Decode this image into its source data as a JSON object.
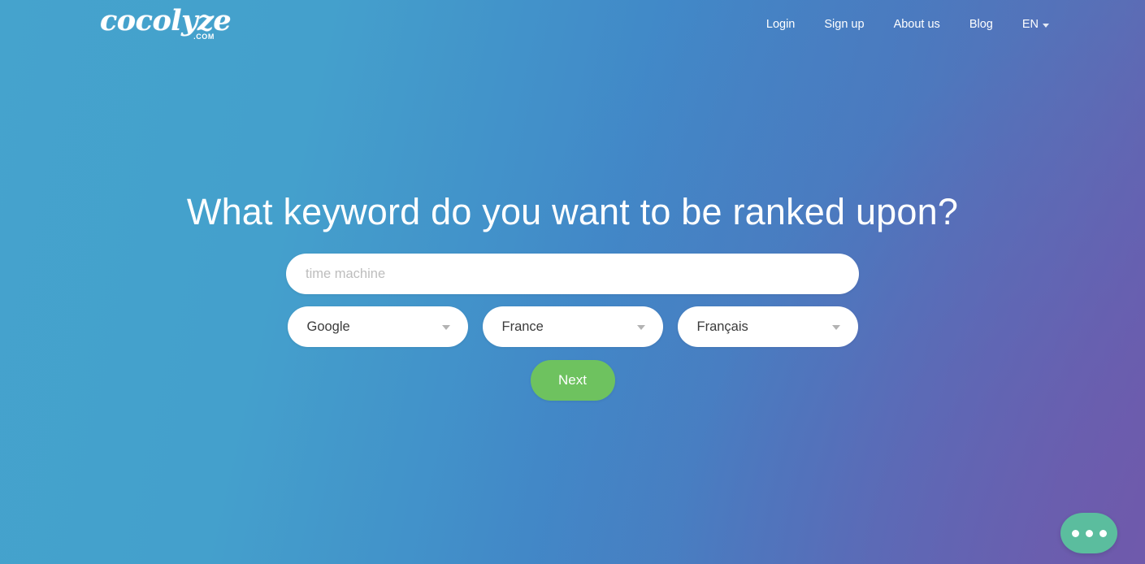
{
  "header": {
    "logo": {
      "word": "cocolyze",
      "suffix": ".COM"
    },
    "nav": [
      {
        "label": "Login",
        "name": "nav-login"
      },
      {
        "label": "Sign up",
        "name": "nav-signup"
      },
      {
        "label": "About us",
        "name": "nav-about-us"
      },
      {
        "label": "Blog",
        "name": "nav-blog"
      }
    ],
    "language": {
      "label": "EN",
      "icon": "chevron-down-icon"
    }
  },
  "hero": {
    "headline": "What keyword do you want to be ranked upon?",
    "search": {
      "value": "",
      "placeholder": "time machine"
    },
    "selects": [
      {
        "label": "Google",
        "icon": "chevron-down-icon"
      },
      {
        "label": "France",
        "icon": "chevron-down-icon"
      },
      {
        "label": "Français",
        "icon": "chevron-down-icon"
      }
    ],
    "next_label": "Next"
  },
  "chat": {
    "icon": "chat-bubble-icon",
    "dots": 3
  },
  "colors": {
    "background_start": "#45a3cd",
    "background_end": "#6a5fae",
    "accent_green": "#6ec25f",
    "chat_teal": "#5bbd9e",
    "text_white": "#ffffff",
    "select_text": "#3b3b3b",
    "placeholder": "#bdbdbd"
  }
}
